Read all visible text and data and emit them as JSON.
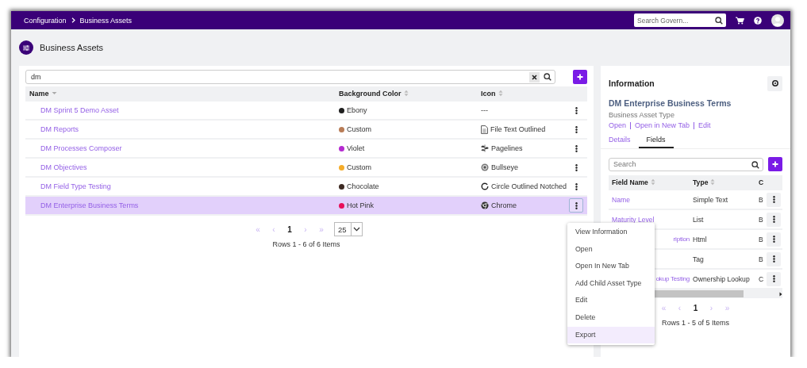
{
  "topbar": {
    "breadcrumbs": [
      "Configuration",
      "Business Assets"
    ],
    "search": {
      "placeholder": "Search Govern..."
    }
  },
  "page": {
    "title": "Business Assets"
  },
  "assets": {
    "search": {
      "value": "dm"
    },
    "columns": [
      {
        "label": "Name",
        "kind": "sorted"
      },
      {
        "label": "Background Color",
        "kind": "sortable"
      },
      {
        "label": "Icon",
        "kind": "sortable"
      }
    ],
    "rows": [
      {
        "name": "DM Sprint 5 Demo Asset",
        "color_name": "Ebony",
        "color": "#1f1f1f",
        "kind": "none",
        "icon_label": "---",
        "selected": false
      },
      {
        "name": "DM Reports",
        "color_name": "Custom",
        "color": "#b87c56",
        "kind": "file",
        "icon_label": "File Text Outlined",
        "selected": false
      },
      {
        "name": "DM Processes Composer",
        "color_name": "Violet",
        "color": "#b52bd0",
        "kind": "leaf",
        "icon_label": "Pagelines",
        "selected": false
      },
      {
        "name": "DM Objectives",
        "color_name": "Custom",
        "color": "#f5ac2a",
        "kind": "bullseye",
        "icon_label": "Bullseye",
        "selected": false
      },
      {
        "name": "DM Field Type Testing",
        "color_name": "Chocolate",
        "color": "#3d2a22",
        "kind": "notched",
        "icon_label": "Circle Outlined Notched",
        "selected": false
      },
      {
        "name": "DM Enterprise Business Terms",
        "color_name": "Hot Pink",
        "color": "#e8105a",
        "kind": "logo",
        "icon_label": "Chrome",
        "selected": true
      }
    ],
    "pager": {
      "buttons": [
        {
          "label": "«",
          "disabled": true
        },
        {
          "label": "‹",
          "disabled": true
        },
        {
          "label": "1",
          "disabled": false
        },
        {
          "label": "›",
          "disabled": true
        },
        {
          "label": "»",
          "disabled": true
        }
      ],
      "page_size": "25"
    },
    "summary": "Rows 1 - 6 of 6 Items"
  },
  "menu": {
    "items": [
      {
        "label": "View Information",
        "selected": false
      },
      {
        "label": "Open",
        "selected": false
      },
      {
        "label": "Open In New Tab",
        "selected": false
      },
      {
        "label": "Add Child Asset Type",
        "selected": false
      },
      {
        "label": "Edit",
        "selected": false
      },
      {
        "label": "Delete",
        "selected": false
      },
      {
        "label": "Export",
        "selected": true
      }
    ]
  },
  "info": {
    "title": "Information",
    "asset_name": "DM Enterprise Business Terms",
    "asset_type": "Business Asset Type",
    "links": [
      "Open",
      "Open in New Tab",
      "Edit"
    ],
    "tabs": [
      {
        "label": "Details",
        "selected": false
      },
      {
        "label": "Fields",
        "selected": true
      }
    ],
    "search": {
      "placeholder": "Search"
    },
    "columns": [
      {
        "label": "Field Name",
        "kind": "sortable"
      },
      {
        "label": "Type",
        "kind": "sortable"
      },
      {
        "label": "C",
        "kind": "plain"
      }
    ],
    "rows": [
      {
        "name": "Name",
        "kind": "link",
        "type": "Simple Text",
        "column_3": "B"
      },
      {
        "name": "Maturity Level",
        "kind": "link",
        "type": "List",
        "column_3": "B"
      },
      {
        "name": "ription",
        "kind": "covered",
        "type": "Html",
        "column_3": "B"
      },
      {
        "kind": "covered",
        "type": "Tag",
        "column_3": "B"
      },
      {
        "name": "okup Testing",
        "kind": "covered",
        "type": "Ownership Lookup",
        "column_3": "C"
      }
    ],
    "pager": {
      "buttons": [
        {
          "label": "«",
          "disabled": true
        },
        {
          "label": "‹",
          "disabled": true
        },
        {
          "label": "1",
          "disabled": false
        },
        {
          "label": "›",
          "disabled": true
        },
        {
          "label": "»",
          "disabled": true
        }
      ]
    },
    "summary": "Rows 1 - 5 of 5 Items"
  }
}
